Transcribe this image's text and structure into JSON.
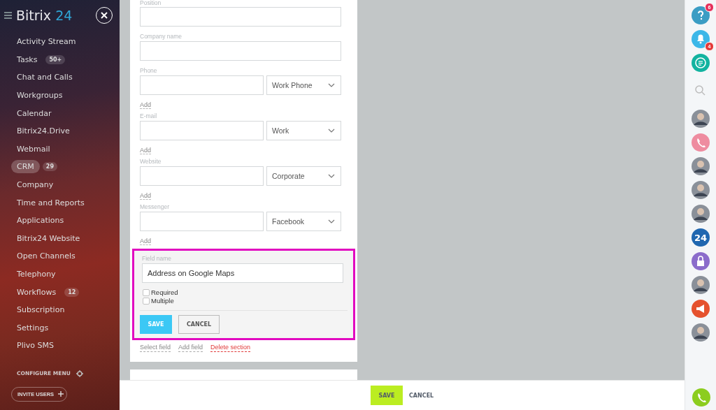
{
  "sidebar": {
    "logo": {
      "name": "Bitrix",
      "number": "24"
    },
    "items": [
      {
        "label": "Activity Stream",
        "selected": false
      },
      {
        "label": "Tasks",
        "counter": "50+",
        "selected": false
      },
      {
        "label": "Chat and Calls",
        "selected": false
      },
      {
        "label": "Workgroups",
        "selected": false
      },
      {
        "label": "Calendar",
        "selected": false
      },
      {
        "label": "Bitrix24.Drive",
        "selected": false
      },
      {
        "label": "Webmail",
        "selected": false
      },
      {
        "label": "CRM",
        "counter": "29",
        "selected": true
      },
      {
        "label": "Company",
        "selected": false
      },
      {
        "label": "Time and Reports",
        "selected": false
      },
      {
        "label": "Applications",
        "selected": false
      },
      {
        "label": "Bitrix24 Website",
        "selected": false
      },
      {
        "label": "Open Channels",
        "selected": false
      },
      {
        "label": "Telephony",
        "selected": false
      },
      {
        "label": "Workflows",
        "counter": "12",
        "selected": false
      },
      {
        "label": "Subscription",
        "selected": false
      },
      {
        "label": "Settings",
        "selected": false
      },
      {
        "label": "Plivo SMS",
        "selected": false
      }
    ],
    "configure": "CONFIGURE MENU",
    "invite": "INVITE USERS"
  },
  "form": {
    "fields": [
      {
        "kind": "text",
        "label": "Position"
      },
      {
        "kind": "text",
        "label": "Company name"
      },
      {
        "kind": "multi",
        "label": "Phone",
        "select": "Work Phone",
        "add": "Add"
      },
      {
        "kind": "multi",
        "label": "E-mail",
        "select": "Work",
        "add": "Add"
      },
      {
        "kind": "multi",
        "label": "Website",
        "select": "Corporate",
        "add": "Add"
      },
      {
        "kind": "multi",
        "label": "Messenger",
        "select": "Facebook",
        "add": "Add"
      }
    ],
    "editor": {
      "label": "Field name",
      "value": "Address on Google Maps",
      "checkboxes": [
        {
          "label": "Required",
          "checked": false
        },
        {
          "label": "Multiple",
          "checked": false
        }
      ],
      "save": "SAVE",
      "cancel": "CANCEL"
    },
    "links": [
      {
        "label": "Select field",
        "kind": "normal"
      },
      {
        "label": "Add field",
        "kind": "normal"
      },
      {
        "label": "Delete section",
        "kind": "danger"
      }
    ]
  },
  "footer": {
    "save": "SAVE",
    "cancel": "CANCEL"
  },
  "right_bar": [
    {
      "kind": "help",
      "badge": "6"
    },
    {
      "kind": "bell",
      "badge": "4"
    },
    {
      "kind": "chat"
    },
    {
      "kind": "search"
    },
    {
      "kind": "avatar"
    },
    {
      "kind": "phone"
    },
    {
      "kind": "avatar"
    },
    {
      "kind": "avatar"
    },
    {
      "kind": "avatar"
    },
    {
      "kind": "logo",
      "text": "24"
    },
    {
      "kind": "lock"
    },
    {
      "kind": "avatar"
    },
    {
      "kind": "megaphone"
    },
    {
      "kind": "avatar"
    }
  ],
  "call_button": {
    "kind": "phone"
  }
}
